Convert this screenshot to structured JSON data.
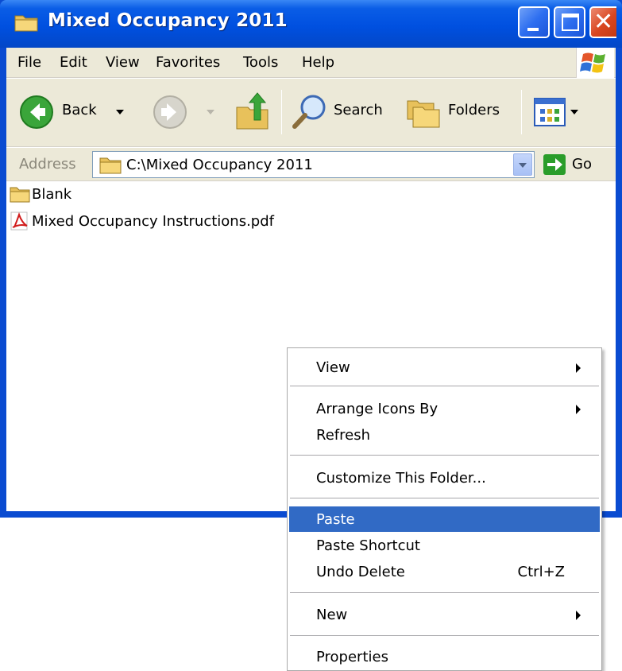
{
  "window": {
    "title": "Mixed Occupancy 2011"
  },
  "menubar": {
    "items": [
      "File",
      "Edit",
      "View",
      "Favorites",
      "Tools",
      "Help"
    ]
  },
  "toolbar": {
    "back_label": "Back",
    "search_label": "Search",
    "folders_label": "Folders"
  },
  "address": {
    "label": "Address",
    "value": "C:\\Mixed Occupancy 2011",
    "go_label": "Go"
  },
  "files": [
    {
      "name": "Blank",
      "icon": "folder-icon"
    },
    {
      "name": "Mixed Occupancy Instructions.pdf",
      "icon": "pdf-icon"
    }
  ],
  "context_menu": {
    "view": "View",
    "arrange_icons_by": "Arrange Icons By",
    "refresh": "Refresh",
    "customize_folder": "Customize This Folder...",
    "paste": "Paste",
    "paste_shortcut": "Paste Shortcut",
    "undo_delete": "Undo Delete",
    "undo_delete_shortcut": "Ctrl+Z",
    "new": "New",
    "properties": "Properties"
  },
  "colors": {
    "title_bar": "#0050e0",
    "highlight": "#316ac5",
    "chrome": "#ece9d8"
  }
}
